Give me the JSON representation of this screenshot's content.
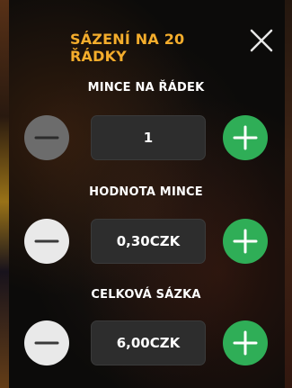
{
  "dialog": {
    "title": "SÁZENÍ NA 20 ŘÁDKY",
    "close_icon": "close-icon"
  },
  "rows": [
    {
      "label": "MINCE NA ŘÁDEK",
      "value": "1",
      "minus_enabled": false,
      "minus_icon": "minus-icon",
      "plus_icon": "plus-icon"
    },
    {
      "label": "HODNOTA MINCE",
      "value": "0,30CZK",
      "minus_enabled": true,
      "minus_icon": "minus-icon",
      "plus_icon": "plus-icon"
    },
    {
      "label": "CELKOVÁ SÁZKA",
      "value": "6,00CZK",
      "minus_enabled": true,
      "minus_icon": "minus-icon",
      "plus_icon": "plus-icon"
    }
  ],
  "colors": {
    "title": "#f4ad2c",
    "plus_button": "#2fae57",
    "minus_button": "#e9e9e9",
    "minus_button_disabled": "#6c6c6c",
    "value_box": "#2d2d2d"
  }
}
